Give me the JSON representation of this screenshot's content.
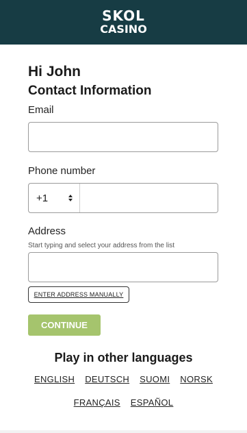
{
  "header": {
    "logo_line1": "SKOL",
    "logo_line2": "CASINO",
    "background": "#173c44"
  },
  "form": {
    "greeting": "Hi John",
    "section_title": "Contact Information",
    "email": {
      "label": "Email",
      "value": "",
      "placeholder": ""
    },
    "phone": {
      "label": "Phone number",
      "country_code": "+1",
      "value": "",
      "placeholder": ""
    },
    "address": {
      "label": "Address",
      "hint": "Start typing and select your address from the list",
      "value": "",
      "placeholder": ""
    },
    "manual_button_label": "ENTER ADDRESS MANUALLY",
    "continue_label": "CONTINUE",
    "continue_color": "#a5c46d"
  },
  "languages": {
    "title": "Play in other languages",
    "row1": [
      "ENGLISH",
      "DEUTSCH",
      "SUOMI",
      "NORSK"
    ],
    "row2": [
      "FRANÇAIS",
      "ESPAÑOL"
    ]
  }
}
